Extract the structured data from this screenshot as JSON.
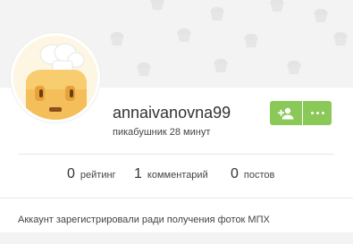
{
  "profile": {
    "username": "annaivanovna99",
    "subtitle": "пикабушник 28 минут",
    "about": "Аккаунт зарегистрировали ради получения фоток МПХ"
  },
  "actions": {
    "add_icon": "user-plus-icon",
    "more_icon": "more-dots-icon"
  },
  "stats": [
    {
      "value": "0",
      "label": "рейтинг"
    },
    {
      "value": "1",
      "label": "комментарий"
    },
    {
      "value": "0",
      "label": "постов"
    }
  ],
  "colors": {
    "accent_green": "#8ac858",
    "cover_background": "#f3f3f3",
    "text_primary": "#333333"
  }
}
